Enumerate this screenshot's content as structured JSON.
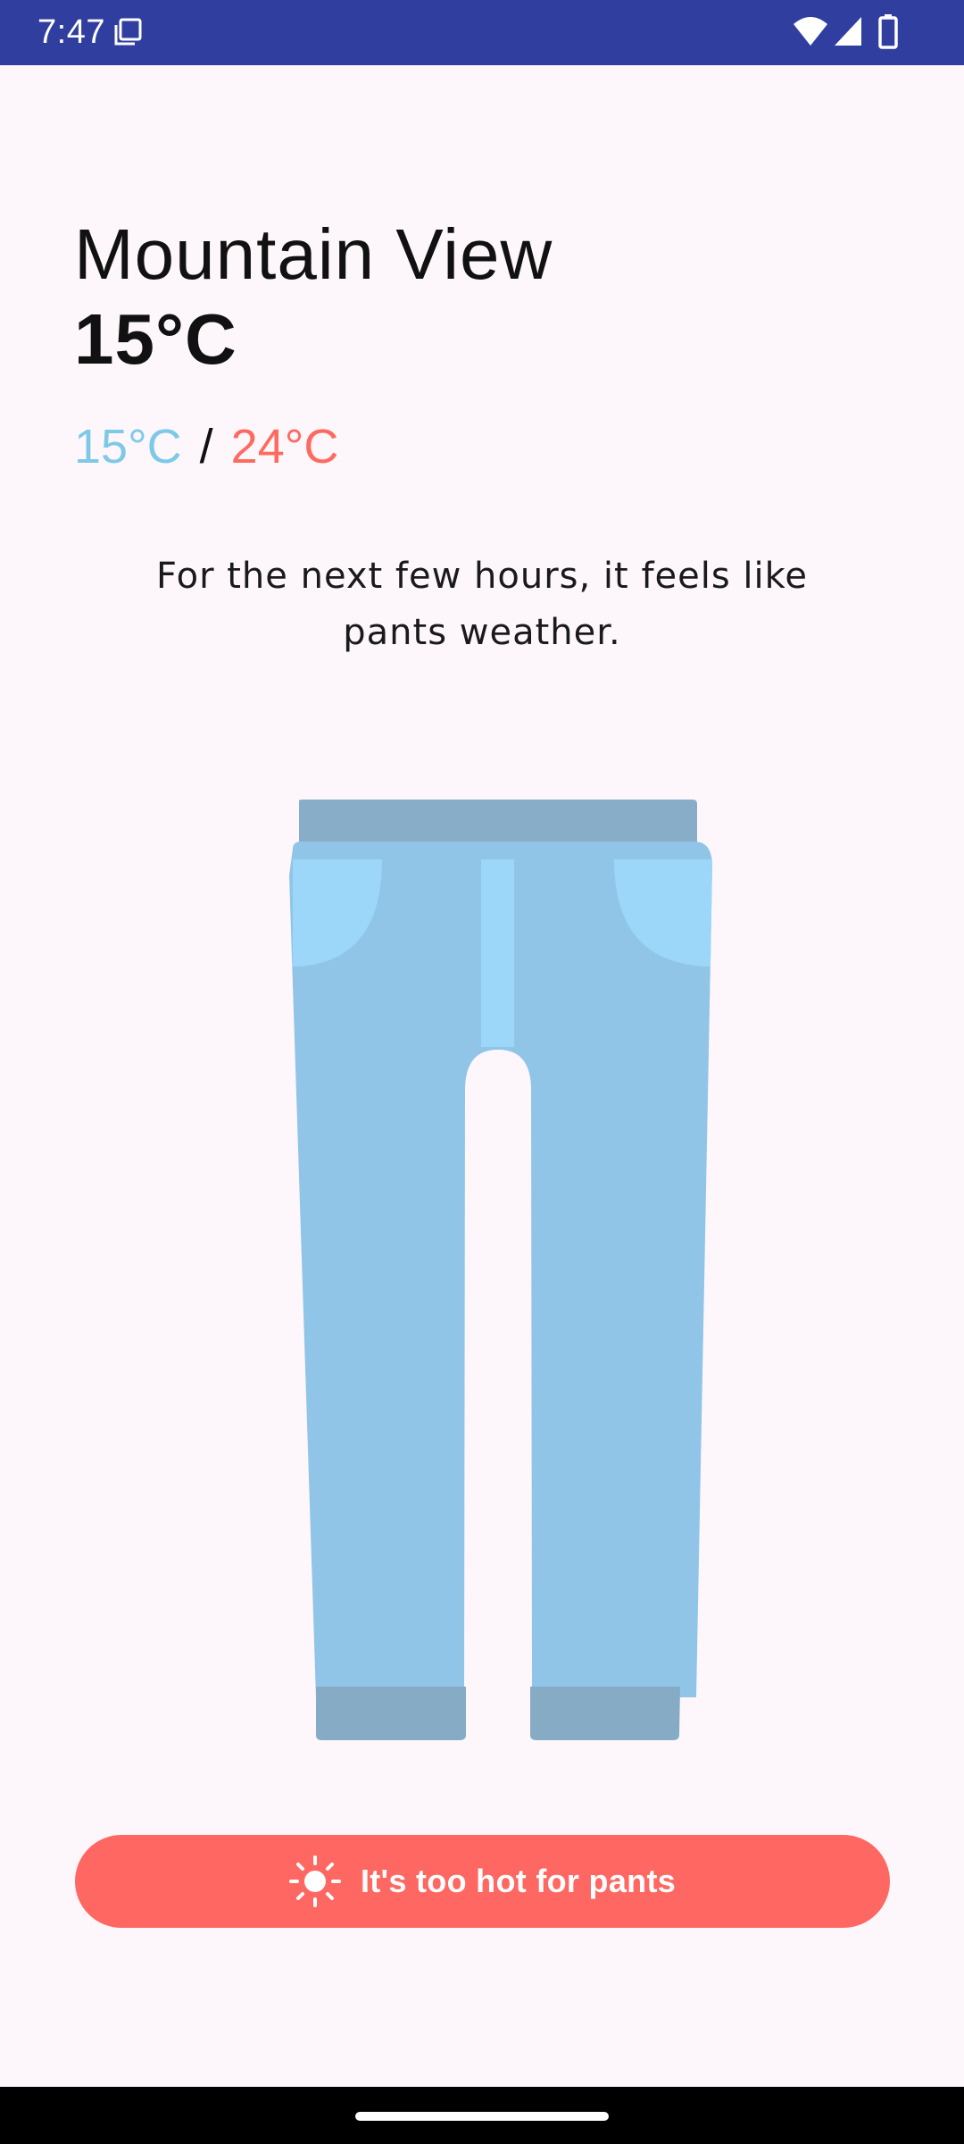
{
  "status_bar": {
    "time": "7:47",
    "background": "#303F9F"
  },
  "weather": {
    "city": "Mountain View",
    "current_temp": "15°C",
    "low_temp": "15°C",
    "separator": "/",
    "high_temp": "24°C",
    "low_color": "#7FC9E8",
    "high_color": "#FF6A60",
    "message": "For the next few hours, it feels like pants weather."
  },
  "illustration": {
    "icon": "pants-icon"
  },
  "action": {
    "label": "It's too hot for pants",
    "icon": "sun-icon",
    "color": "#FF6762"
  }
}
